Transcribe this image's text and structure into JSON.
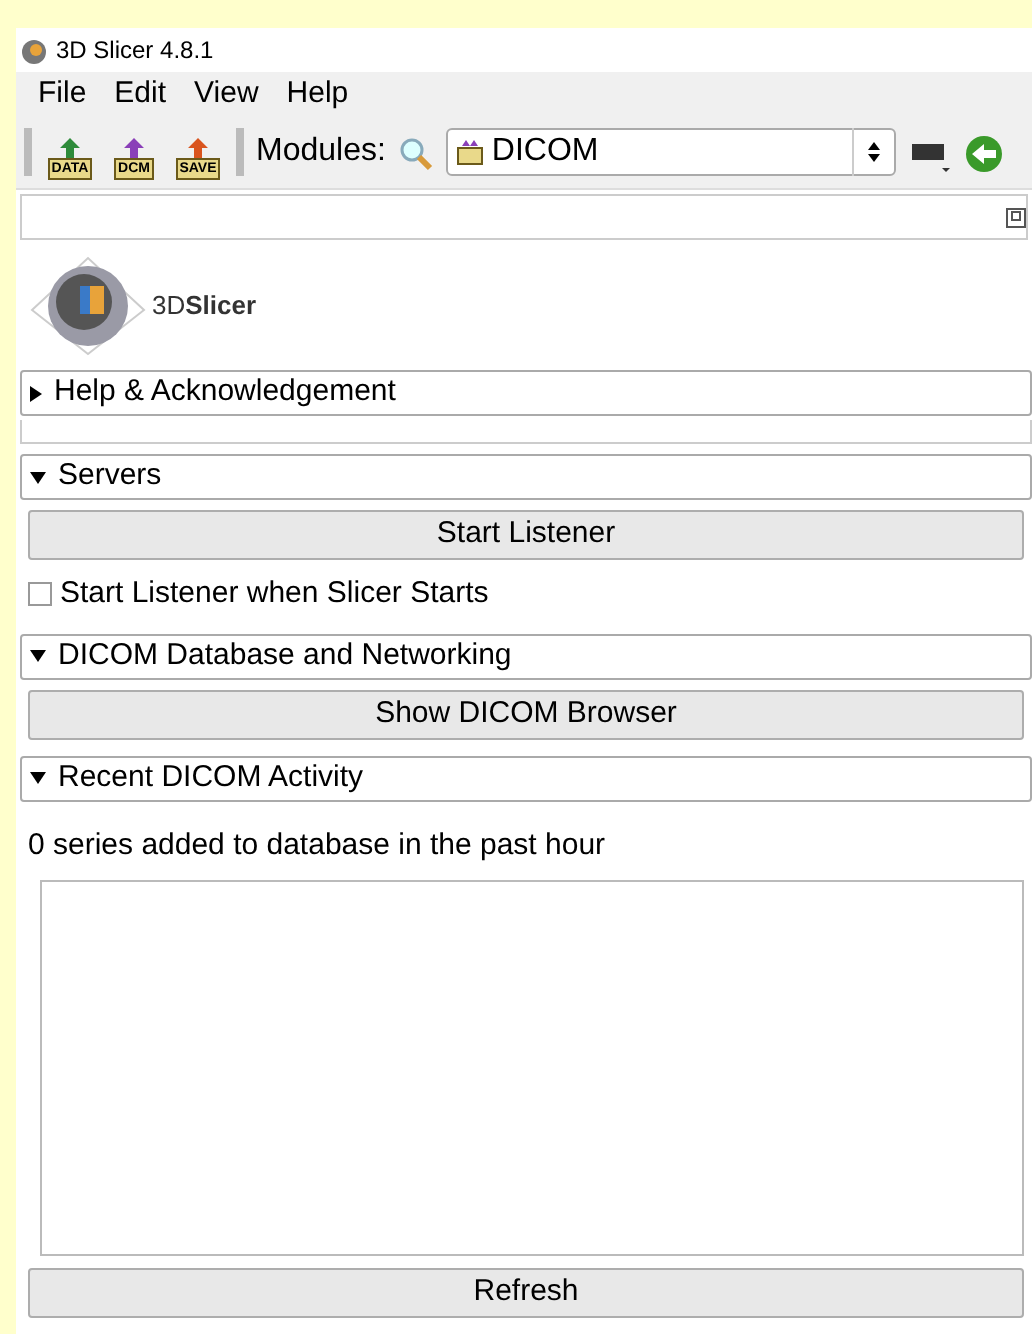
{
  "window": {
    "title": "3D Slicer 4.8.1"
  },
  "menu": [
    "File",
    "Edit",
    "View",
    "Help"
  ],
  "toolbar": {
    "buttons": [
      {
        "label": "DATA",
        "color": "#2e8b3a"
      },
      {
        "label": "DCM",
        "color": "#8a3fb8"
      },
      {
        "label": "SAVE",
        "color": "#d9541e"
      }
    ],
    "modules_label": "Modules:",
    "module_select": {
      "value": "DICOM"
    }
  },
  "logo": {
    "text": "3D**Slicer**"
  },
  "sections": [
    {
      "title": "Help & Acknowledgement",
      "expanded": false
    },
    {
      "title": "Servers",
      "expanded": true,
      "items": [
        {
          "kind": "button",
          "label": "Start Listener"
        },
        {
          "kind": "checkbox",
          "label": "Start Listener when Slicer Starts",
          "checked": false
        }
      ]
    },
    {
      "title": "DICOM Database and Networking",
      "expanded": true,
      "items": [
        {
          "kind": "button",
          "label": "Show DICOM Browser"
        }
      ]
    },
    {
      "title": "Recent DICOM Activity",
      "expanded": true,
      "items": [
        {
          "kind": "text",
          "label": "0 series added to database in the past hour"
        },
        {
          "kind": "log"
        },
        {
          "kind": "button",
          "label": "Refresh"
        }
      ]
    }
  ]
}
